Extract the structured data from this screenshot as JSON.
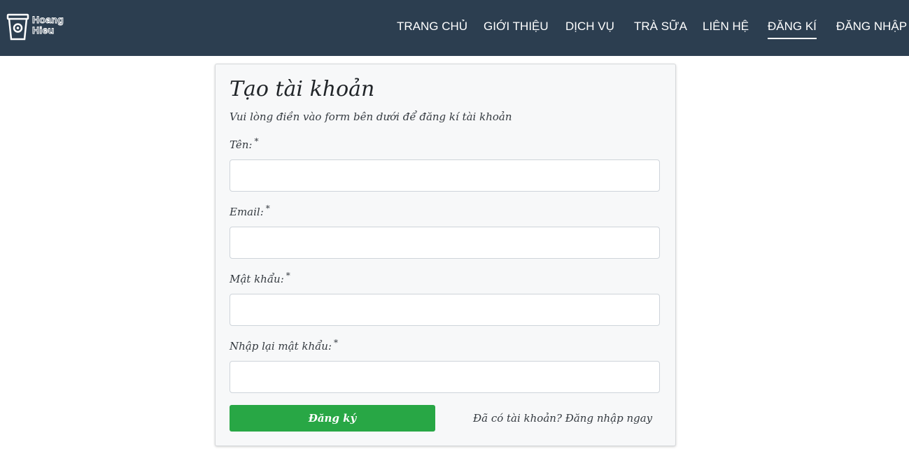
{
  "header": {
    "logo_text_line1": "Hoang",
    "logo_text_line2": "Hieu",
    "nav": [
      {
        "label": "TRANG CHỦ"
      },
      {
        "label": "GIỚI THIỆU"
      },
      {
        "label": "DỊCH VỤ"
      },
      {
        "label": "TRÀ SỮA"
      },
      {
        "label": "LIÊN HỆ"
      },
      {
        "label": "ĐĂNG KÍ",
        "active": true
      },
      {
        "label": "ĐĂNG NHẬP"
      }
    ]
  },
  "form": {
    "title": "Tạo tài khoản",
    "subtitle": "Vui lòng điền vào form bên dưới để đăng kí tài khoản",
    "required_mark": "*",
    "fields": [
      {
        "label": "Tên:",
        "value": "",
        "placeholder": ""
      },
      {
        "label": "Email:",
        "value": "",
        "placeholder": ""
      },
      {
        "label": "Mật khẩu:",
        "value": "",
        "placeholder": ""
      },
      {
        "label": "Nhập lại mật khẩu:",
        "value": "",
        "placeholder": ""
      }
    ],
    "submit_label": "Đăng ký",
    "login_link": "Đã có tài khoản? Đăng nhập ngay"
  },
  "colors": {
    "navbar": "#2c3e50",
    "submit": "#28a745",
    "card": "#f7f8f9"
  }
}
